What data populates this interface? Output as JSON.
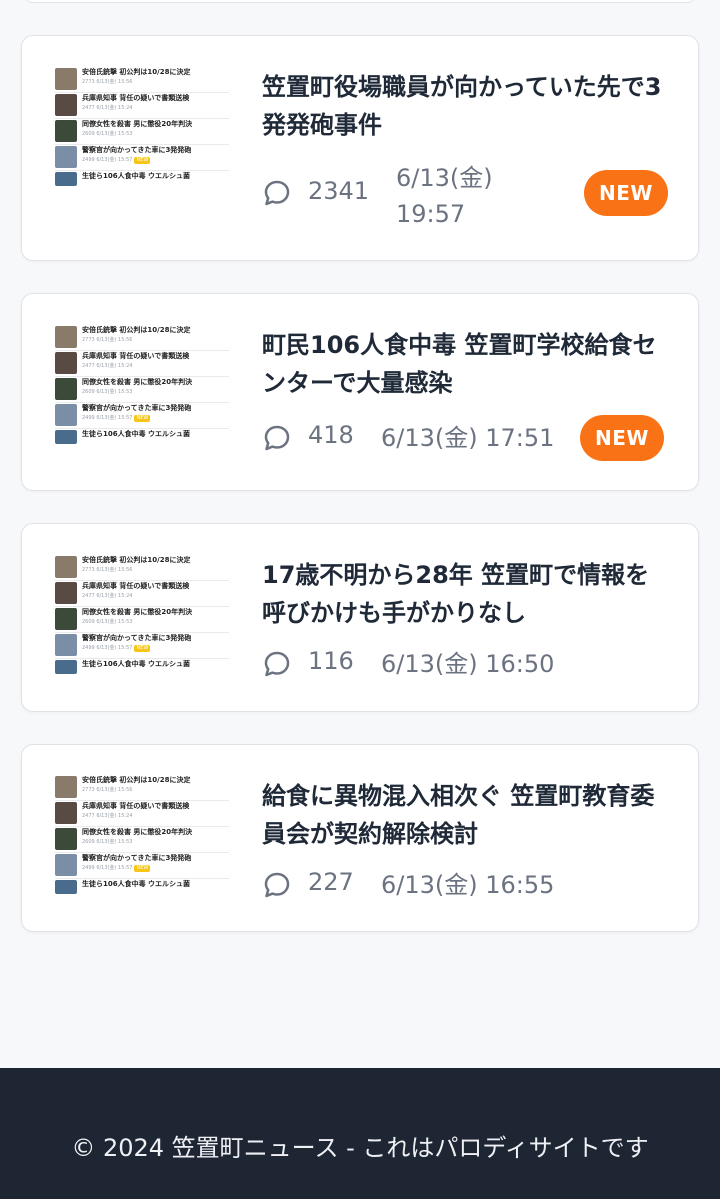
{
  "thumbnail": {
    "rows": [
      {
        "title": "安倍氏銃撃 初公判は10/28に決定",
        "meta": "2773 6/13(金) 15:56",
        "tag": "",
        "color": "#8a7a6a"
      },
      {
        "title": "兵庫県知事 背任の疑いで書類送検",
        "meta": "2477 6/13(金) 15:24",
        "tag": "",
        "color": "#5a4a44"
      },
      {
        "title": "同僚女性を殺害 男に懲役20年判決",
        "meta": "2609 6/13(金) 15:53",
        "tag": "",
        "color": "#3c4a3a"
      },
      {
        "title": "警察官が向かってきた車に3発発砲",
        "meta": "2499 6/13(金) 15:57",
        "tag": "NEW",
        "color": "#7a8ea6"
      },
      {
        "title": "生徒ら106人食中毒 ウエルシュ菌",
        "meta": "",
        "tag": "",
        "color": "#4a6c8c"
      }
    ]
  },
  "articles": [
    {
      "headline": "笠置町役場職員が向かっていた先で3発発砲事件",
      "comments": "2341",
      "date_line1": "6/13(金)",
      "date_line2": "19:57",
      "date": "",
      "badge": "NEW"
    },
    {
      "headline": "町民106人食中毒 笠置町学校給食センターで大量感染",
      "comments": "418",
      "date": "6/13(金) 17:51",
      "badge": "NEW"
    },
    {
      "headline": "17歳不明から28年 笠置町で情報を呼びかけも手がかりなし",
      "comments": "116",
      "date": "6/13(金) 16:50",
      "badge": ""
    },
    {
      "headline": "給食に異物混入相次ぐ 笠置町教育委員会が契約解除検討",
      "comments": "227",
      "date": "6/13(金) 16:55",
      "badge": ""
    }
  ],
  "footer": {
    "text": "© 2024 笠置町ニュース - これはパロディサイトです"
  },
  "colors": {
    "accent": "#f97316",
    "footer_bg": "#1e2533"
  },
  "icons": {
    "comment": "comment-icon"
  }
}
